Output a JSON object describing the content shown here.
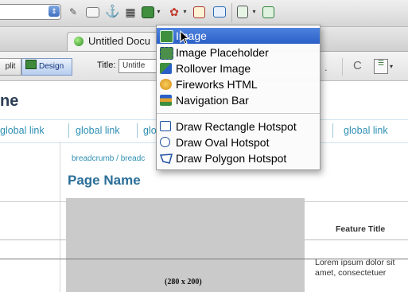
{
  "toolbar": {
    "icons": [
      "format-combo",
      "hyperlink-icon",
      "email-link-icon",
      "named-anchor-icon",
      "table-icon",
      "image-icon",
      "media-icon",
      "date-icon",
      "comment-icon",
      "templates-icon",
      "tag-chooser-icon"
    ],
    "dropdown_arrow_glyph": "▾",
    "combo_arrow_glyph": "⇕"
  },
  "doc_tab": {
    "title": "Untitled Docu"
  },
  "doc_toolbar": {
    "split_label": "plit",
    "design_label": "Design",
    "title_label": "Title:",
    "title_value": "Untitle",
    "refresh_glyph": "C",
    "dot_glyph": "."
  },
  "page": {
    "title_partial": "ne",
    "nav_links": [
      "global link",
      "global link",
      "glo",
      "global link"
    ],
    "breadcrumb": "breadcrumb / breadc",
    "page_name": "Page Name",
    "placeholder_label": "(280 x 200)",
    "feature_title": "Feature Title",
    "lorem": "Lorem ipsum dolor sit amet, consectetuer"
  },
  "menu": {
    "items": [
      {
        "label": "Image",
        "icon": "image-icon",
        "selected": true
      },
      {
        "label": "Image Placeholder",
        "icon": "image-placeholder-icon",
        "selected": false
      },
      {
        "label": "Rollover Image",
        "icon": "rollover-image-icon",
        "selected": false
      },
      {
        "label": "Fireworks HTML",
        "icon": "fireworks-icon",
        "selected": false
      },
      {
        "label": "Navigation Bar",
        "icon": "navigation-bar-icon",
        "selected": false
      },
      {
        "label": "Draw Rectangle Hotspot",
        "icon": "rectangle-hotspot-icon",
        "selected": false
      },
      {
        "label": "Draw Oval Hotspot",
        "icon": "oval-hotspot-icon",
        "selected": false
      },
      {
        "label": "Draw Polygon Hotspot",
        "icon": "polygon-hotspot-icon",
        "selected": false
      }
    ]
  },
  "colors": {
    "menu_highlight": "#2a5fc7",
    "link": "#2e8fb2",
    "page_name": "#2b6e98",
    "placeholder": "#cacaca"
  }
}
